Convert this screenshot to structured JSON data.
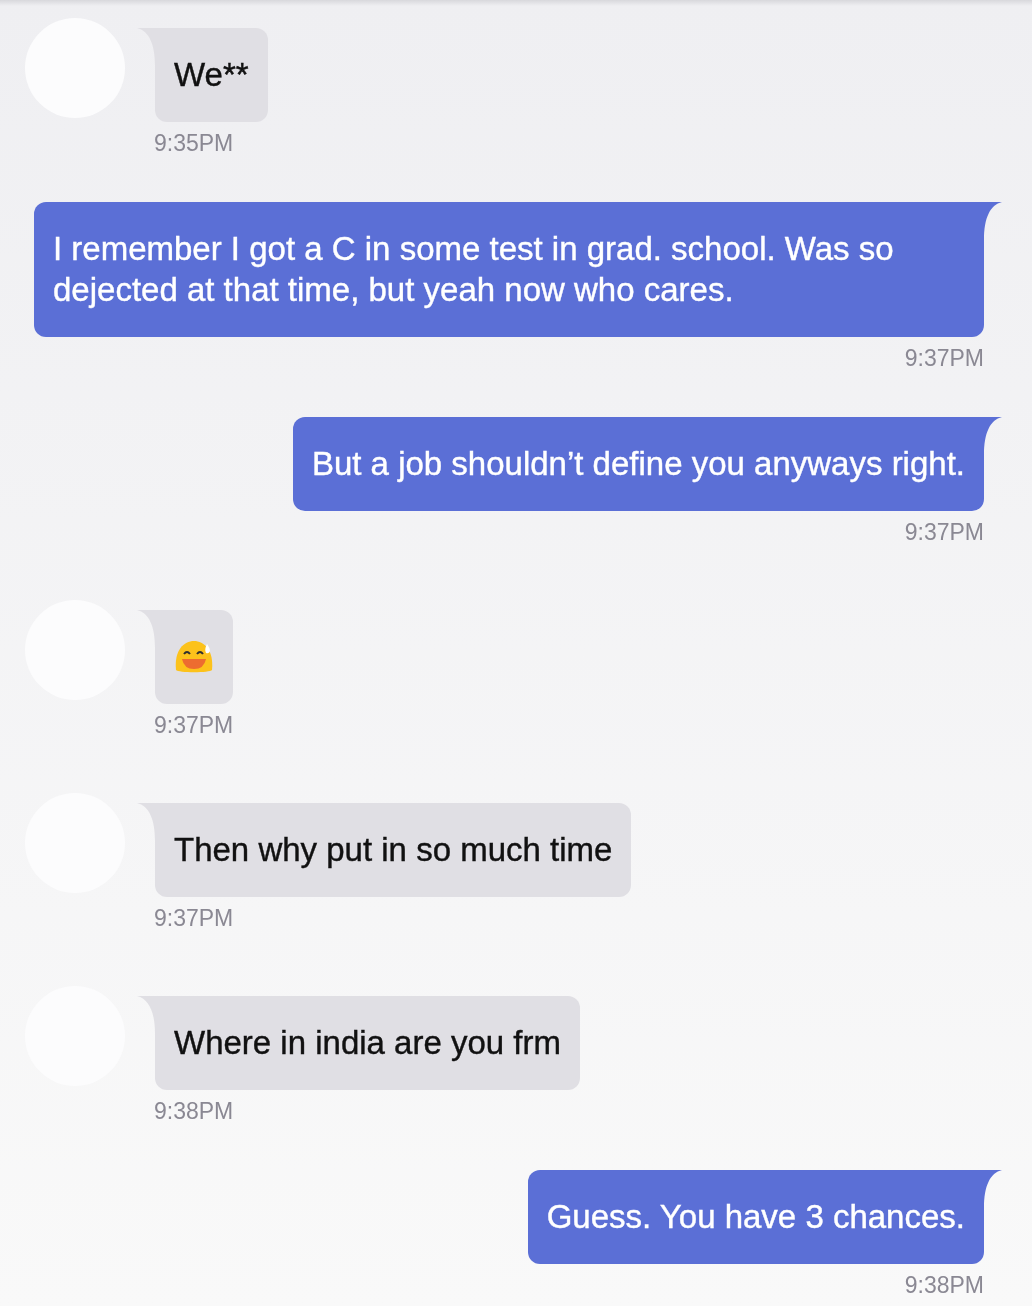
{
  "messages": [
    {
      "outgoing": false,
      "kind": "text",
      "text": "We**",
      "time": "9:35PM"
    },
    {
      "outgoing": true,
      "kind": "text",
      "text": "I remember I got a C in some test in grad. school. Was so dejected at that time, but yeah now who cares.",
      "time": "9:37PM"
    },
    {
      "outgoing": true,
      "kind": "text",
      "text": "But a job shouldn’t define you anyways right.",
      "time": "9:37PM"
    },
    {
      "outgoing": false,
      "kind": "emoji",
      "time": "9:37PM"
    },
    {
      "outgoing": false,
      "kind": "text",
      "text": "Then why put in so much time",
      "time": "9:37PM"
    },
    {
      "outgoing": false,
      "kind": "text",
      "text": "Where in india are you frm",
      "time": "9:38PM"
    },
    {
      "outgoing": true,
      "kind": "text",
      "text": "Guess. You have 3 chances.",
      "time": "9:38PM"
    }
  ]
}
